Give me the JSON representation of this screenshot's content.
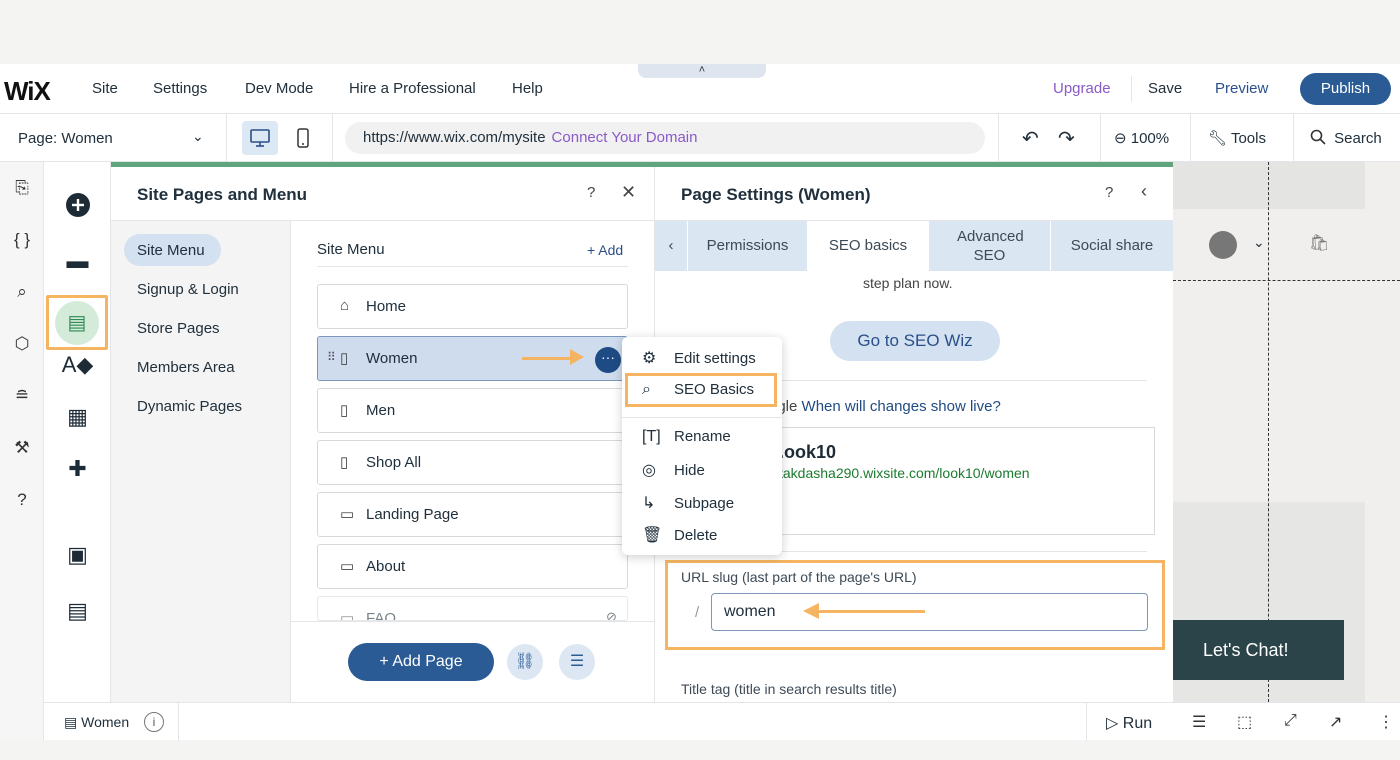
{
  "topbar": {
    "logo": "WiX",
    "menu": [
      "Site",
      "Settings",
      "Dev Mode",
      "Hire a Professional",
      "Help"
    ],
    "collapse_glyph": "˄",
    "upgrade": "Upgrade",
    "save": "Save",
    "preview": "Preview",
    "publish": "Publish"
  },
  "secondbar": {
    "page_select": "Page: Women",
    "url": "https://www.wix.com/mysite",
    "connect_domain": "Connect Your Domain",
    "zoom": "100%",
    "tools": "Tools",
    "search": "Search"
  },
  "pages_panel": {
    "title": "Site Pages and Menu",
    "help": "?",
    "nav": [
      "Site Menu",
      "Signup & Login",
      "Store Pages",
      "Members Area",
      "Dynamic Pages"
    ],
    "menu_title": "Site Menu",
    "add": "+ Add",
    "pages": [
      "Home",
      "Women",
      "Men",
      "Shop All",
      "Landing Page",
      "About",
      "FAQ"
    ],
    "add_page": "+ Add Page"
  },
  "context_menu": {
    "items": [
      "Edit settings",
      "SEO Basics",
      "Rename",
      "Hide",
      "Subpage",
      "Delete"
    ]
  },
  "settings_panel": {
    "title": "Page Settings (Women)",
    "help": "?",
    "tabs": [
      "Permissions",
      "SEO basics",
      "Advanced SEO",
      "Social share"
    ],
    "partial_text": "step plan now.",
    "seo_wiz": "Go to SEO Wiz",
    "google_partial": "ogle",
    "google_link": "When will changes show live?",
    "preview_title": ".ook10",
    "preview_url": "takdasha290.wixsite.com/look10/women",
    "slug_label": "URL slug (last part of the page's URL)",
    "slug_slash": "/",
    "slug_value": "women",
    "title_tag_label": "Title tag (title in search results title)"
  },
  "canvas": {
    "chat": "Let's Chat!"
  },
  "bottombar": {
    "page": "Women",
    "info": "i",
    "run": "Run"
  },
  "colors": {
    "accent": "#2a5b94",
    "highlight": "#f5b461",
    "upgrade": "#8a5ac8",
    "progress": "#60a57e"
  }
}
